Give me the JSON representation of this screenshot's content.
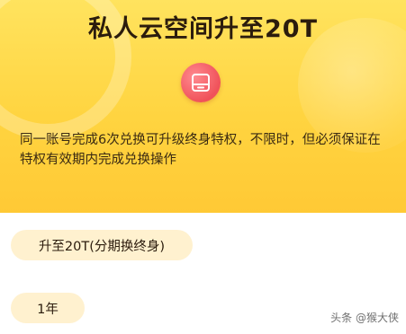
{
  "header": {
    "title": "私人云空间升至20T",
    "description": "同一账号完成6次兑换可升级终身特权，不限时，但必须保证在特权有效期内完成兑换操作",
    "icon": "storage-box-icon"
  },
  "options": [
    {
      "label": "升至20T(分期换终身)"
    },
    {
      "label": "1年"
    }
  ],
  "watermark": "头条 @猴大侠",
  "colors": {
    "hero_top": "#ffe35e",
    "hero_bottom": "#ffc935",
    "icon_bg": "#f0525a",
    "option_bg": "#fff1cf"
  }
}
